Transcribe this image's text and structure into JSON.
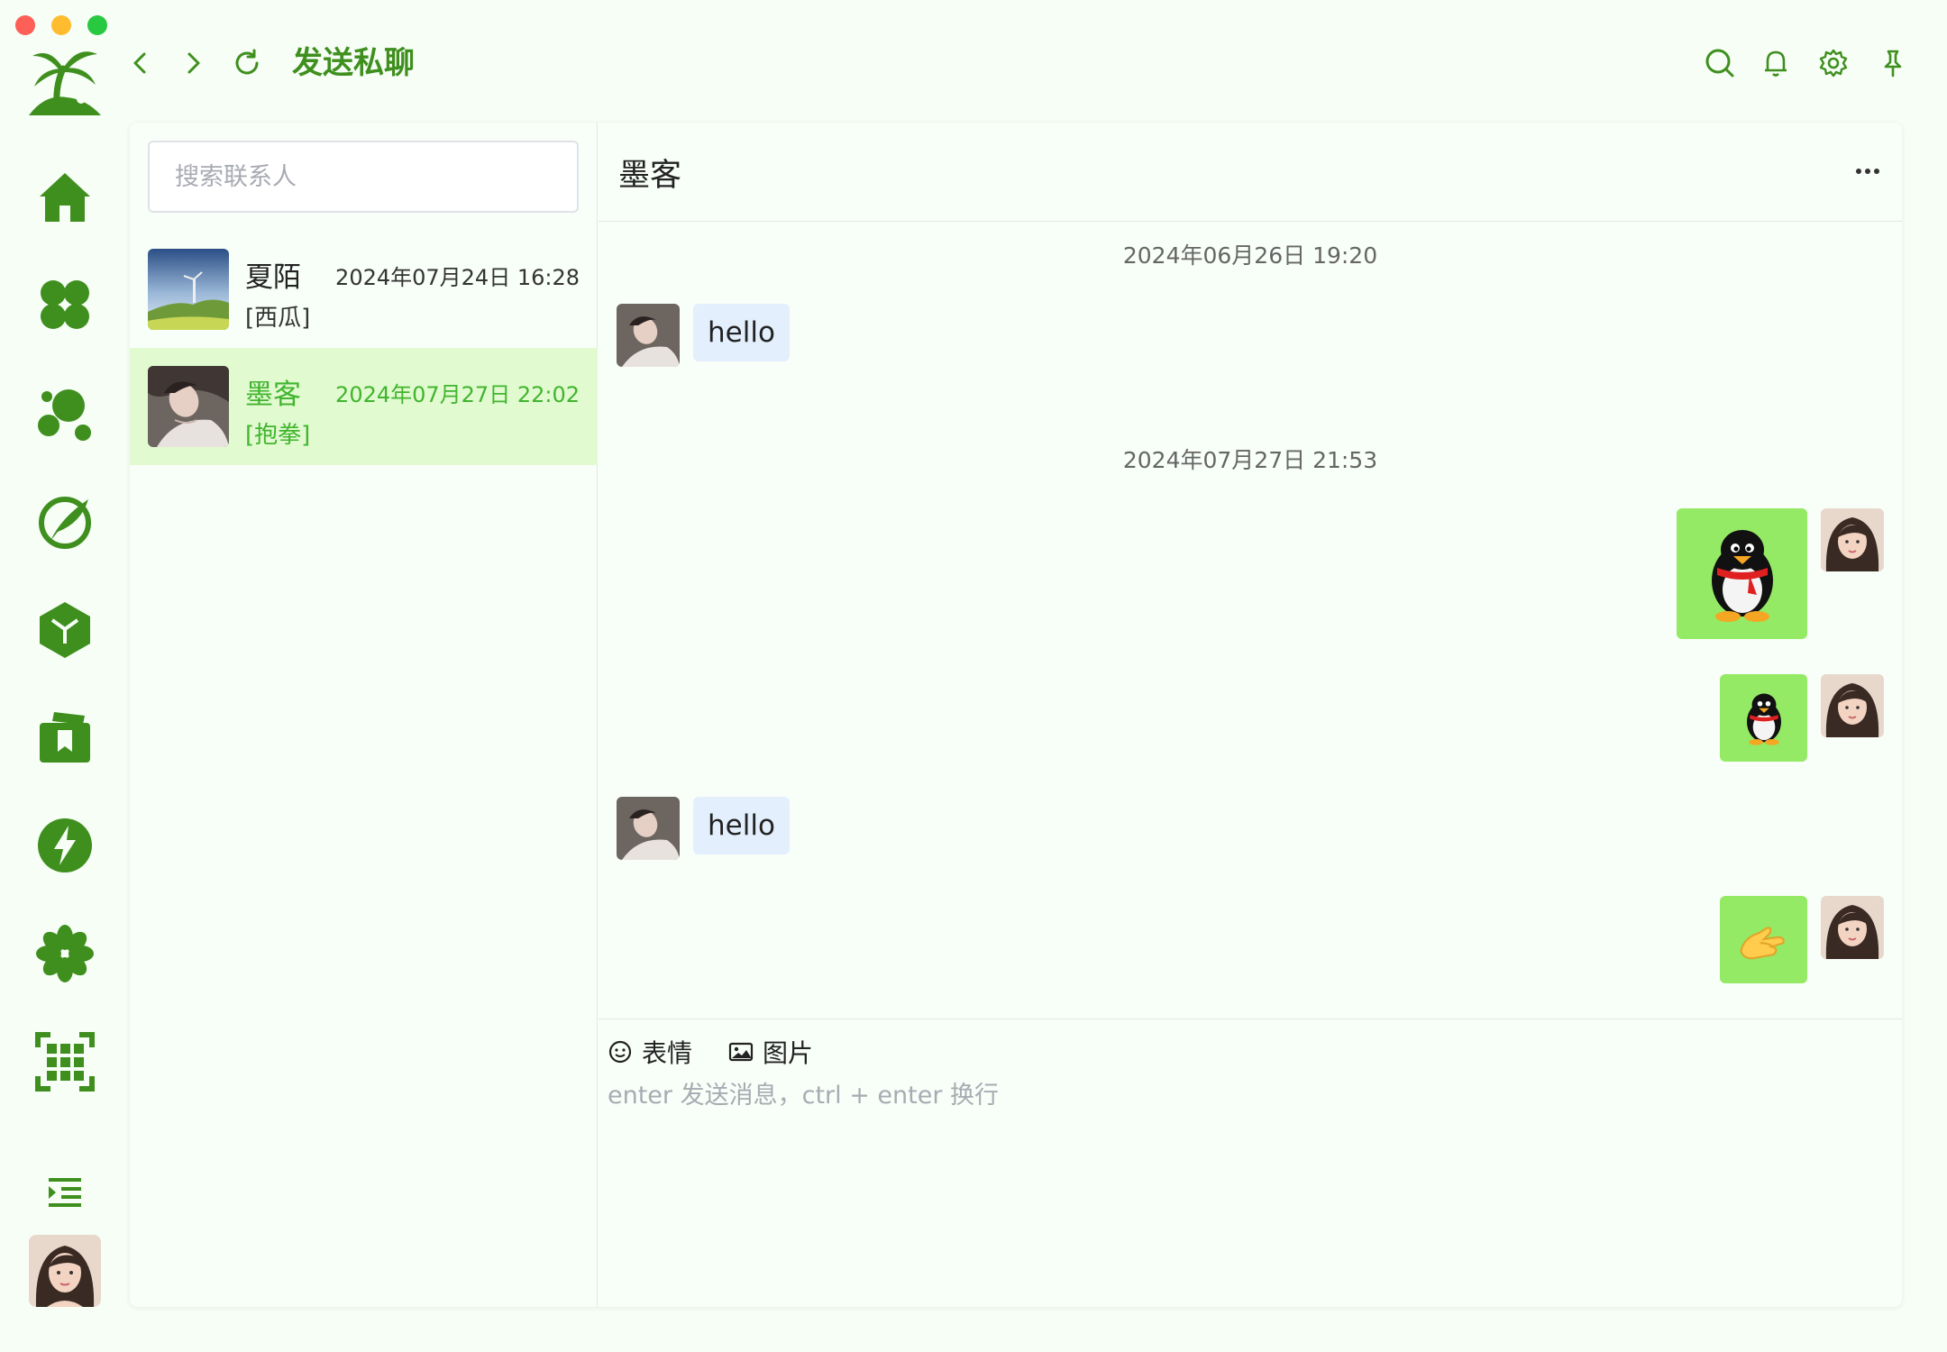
{
  "window": {
    "title": "发送私聊",
    "accent_color": "#3f8f1e",
    "highlight_color": "#41b52e"
  },
  "sidebar": {
    "logo": "palm-tree-logo",
    "items": [
      {
        "name": "home-icon"
      },
      {
        "name": "clover-icon"
      },
      {
        "name": "bubbles-icon"
      },
      {
        "name": "feather-icon"
      },
      {
        "name": "cube-icon"
      },
      {
        "name": "bookmark-folder-icon"
      },
      {
        "name": "lightning-icon"
      },
      {
        "name": "flower-icon"
      },
      {
        "name": "grid-scan-icon"
      }
    ],
    "collapse": "indent-menu-icon"
  },
  "topbar": {
    "actions": [
      "search-icon",
      "bell-icon",
      "gear-icon",
      "pin-icon"
    ]
  },
  "contacts": {
    "search_placeholder": "搜索联系人",
    "items": [
      {
        "name": "夏陌",
        "time": "2024年07月24日 16:28",
        "last": "[西瓜]",
        "active": false
      },
      {
        "name": "墨客",
        "time": "2024年07月27日 22:02",
        "last": "[抱拳]",
        "active": true
      }
    ]
  },
  "chat": {
    "title": "墨客",
    "messages": [
      {
        "type": "timestamp",
        "text": "2024年06月26日 19:20"
      },
      {
        "type": "text",
        "from": "other",
        "text": "hello"
      },
      {
        "type": "timestamp",
        "text": "2024年07月27日 21:53"
      },
      {
        "type": "sticker",
        "from": "me",
        "sticker": "penguin-large"
      },
      {
        "type": "sticker",
        "from": "me",
        "sticker": "penguin-small"
      },
      {
        "type": "text",
        "from": "other",
        "text": "hello"
      },
      {
        "type": "sticker",
        "from": "me",
        "sticker": "fist-salute"
      }
    ]
  },
  "composer": {
    "emoji_label": "表情",
    "image_label": "图片",
    "placeholder": "enter 发送消息，ctrl + enter 换行"
  }
}
